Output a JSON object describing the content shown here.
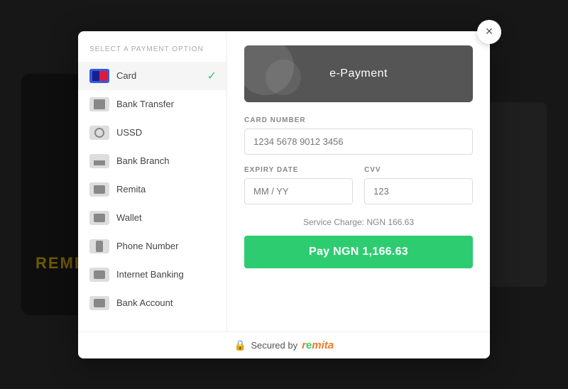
{
  "modal": {
    "close_label": "×",
    "sidebar": {
      "title": "Select a payment option",
      "items": [
        {
          "id": "card",
          "label": "Card",
          "active": true
        },
        {
          "id": "bank-transfer",
          "label": "Bank Transfer",
          "active": false
        },
        {
          "id": "ussd",
          "label": "USSD",
          "active": false
        },
        {
          "id": "bank-branch",
          "label": "Bank Branch",
          "active": false
        },
        {
          "id": "remita",
          "label": "Remita",
          "active": false
        },
        {
          "id": "wallet",
          "label": "Wallet",
          "active": false
        },
        {
          "id": "phone-number",
          "label": "Phone Number",
          "active": false
        },
        {
          "id": "internet-banking",
          "label": "Internet Banking",
          "active": false
        },
        {
          "id": "bank-account",
          "label": "Bank Account",
          "active": false
        }
      ]
    },
    "right_panel": {
      "banner_text": "e-Payment",
      "card_number_label": "Card Number",
      "card_number_placeholder": "1234 5678 9012 3456",
      "expiry_label": "Expiry Date",
      "expiry_placeholder": "MM / YY",
      "cvv_label": "CVV",
      "cvv_placeholder": "123",
      "service_charge": "Service Charge: NGN 166.63",
      "pay_button": "Pay NGN 1,166.63"
    },
    "footer": {
      "secured_text": "Secured by",
      "brand": "remita"
    }
  }
}
